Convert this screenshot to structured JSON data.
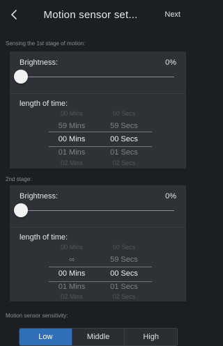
{
  "header": {
    "title": "Motion sensor set...",
    "next_label": "Next"
  },
  "stage1": {
    "section_label": "Sensing the 1st stage of motion:",
    "brightness_label": "Brightness:",
    "brightness_value": "0%",
    "brightness_fraction": 0,
    "time_label": "length of time:",
    "picker": {
      "minutes": [
        "00 Mins",
        "59 Mins",
        "00 Mins",
        "01 Mins",
        "02 Mins"
      ],
      "seconds": [
        "00 Secs",
        "59 Secs",
        "00 Secs",
        "01 Secs",
        "02 Secs"
      ]
    }
  },
  "stage2": {
    "section_label": "2nd stage:",
    "brightness_label": "Brightness:",
    "brightness_value": "0%",
    "brightness_fraction": 0,
    "time_label": "length of time:",
    "picker": {
      "minutes": [
        "00 Mins",
        "∞",
        "00 Mins",
        "01 Mins",
        "02 Mins"
      ],
      "seconds": [
        "00 Secs",
        "59 Secs",
        "00 Secs",
        "01 Secs",
        "02 Secs"
      ]
    }
  },
  "sensitivity": {
    "section_label": "Motion sensor sensitivity:",
    "options": [
      "Low",
      "Middle",
      "High"
    ],
    "selected": "Low"
  },
  "colors": {
    "background": "#1c1f22",
    "card": "#2e3236",
    "accent": "#2f6fb8"
  },
  "icons": {
    "back": "chevron-left-icon"
  }
}
